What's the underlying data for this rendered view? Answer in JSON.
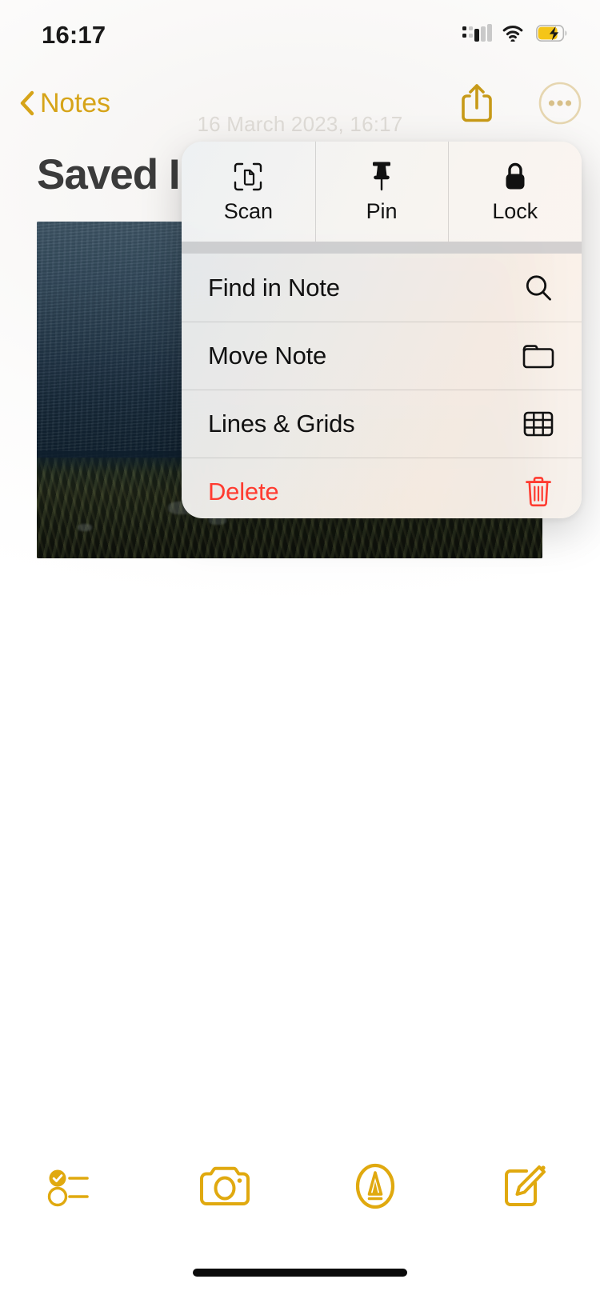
{
  "status_bar": {
    "time": "16:17",
    "cellular_icon": "cellular-signal-icon",
    "wifi_icon": "wifi-icon",
    "battery_icon": "battery-charging-icon",
    "battery_charging": true
  },
  "nav_bar": {
    "back_label": "Notes",
    "back_icon": "chevron-left-icon",
    "share_icon": "share-icon",
    "more_icon": "more-ellipsis-icon"
  },
  "note": {
    "date": "16 March 2023, 16:17",
    "title": "Saved I",
    "attachment_icon": "note-image-attachment"
  },
  "context_menu": {
    "top_actions": [
      {
        "label": "Scan",
        "icon": "scan-document-icon"
      },
      {
        "label": "Pin",
        "icon": "pin-icon"
      },
      {
        "label": "Lock",
        "icon": "lock-icon"
      }
    ],
    "rows": [
      {
        "label": "Find in Note",
        "icon": "search-icon",
        "destructive": false
      },
      {
        "label": "Move Note",
        "icon": "folder-icon",
        "destructive": false
      },
      {
        "label": "Lines & Grids",
        "icon": "grid-table-icon",
        "destructive": false
      },
      {
        "label": "Delete",
        "icon": "trash-icon",
        "destructive": true
      }
    ]
  },
  "toolbar": {
    "items": [
      {
        "name": "checklist",
        "icon": "checklist-icon"
      },
      {
        "name": "camera",
        "icon": "camera-icon"
      },
      {
        "name": "markup",
        "icon": "markup-pen-icon"
      },
      {
        "name": "compose",
        "icon": "compose-new-note-icon"
      }
    ]
  },
  "colors": {
    "accent": "#D6A419",
    "destructive": "#FF3B30",
    "text_primary": "#111111",
    "date_text": "#DEDBD6"
  }
}
